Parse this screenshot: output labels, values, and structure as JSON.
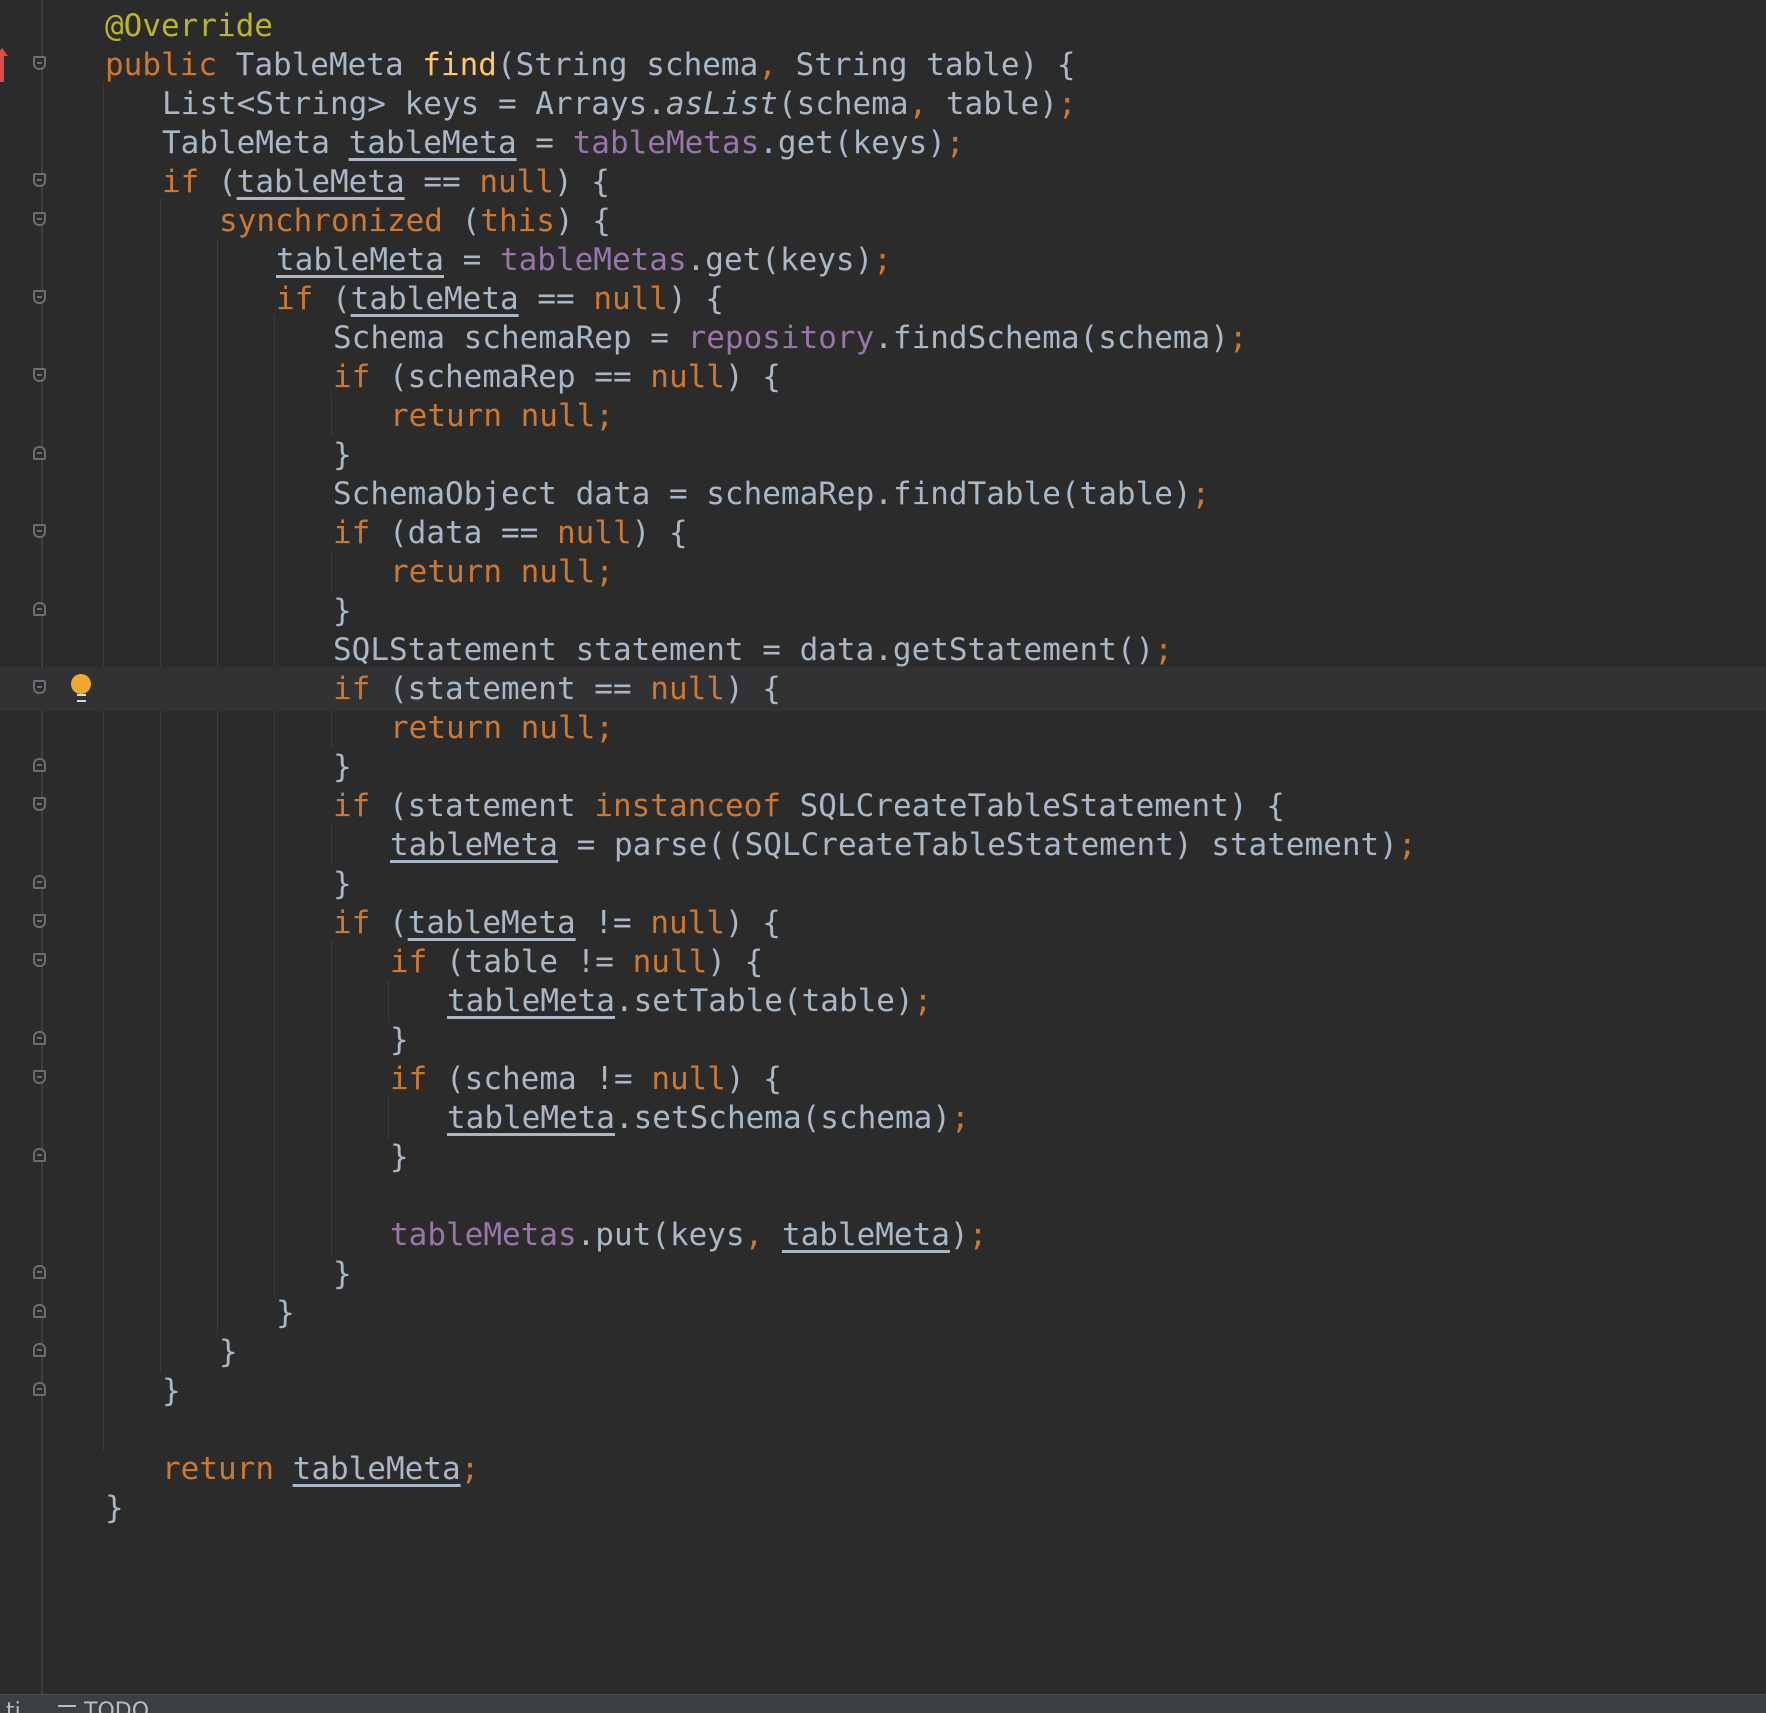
{
  "editor": {
    "language": "java",
    "colors": {
      "background": "#2b2b2c",
      "current_line": "#323234",
      "plain": "#a9b7c6",
      "keyword": "#cc7832",
      "annotation": "#bbb529",
      "method_declaration": "#ffc66d",
      "field": "#9876aa",
      "gutter_icon": "#6a6e72",
      "intention_bulb": "#f0a830",
      "change_marker": "#d94f47"
    },
    "lines": [
      [
        {
          "t": "@Override",
          "c": "annotation"
        }
      ],
      [
        {
          "t": "public ",
          "c": "keyword"
        },
        {
          "t": "TableMeta "
        },
        {
          "t": "find",
          "c": "method_declaration"
        },
        {
          "t": "(String schema"
        },
        {
          "t": ", ",
          "c": "keyword"
        },
        {
          "t": "String table) {"
        }
      ],
      [
        {
          "t": "List<String> keys = Arrays."
        },
        {
          "t": "asList",
          "c": "italic"
        },
        {
          "t": "(schema"
        },
        {
          "t": ", ",
          "c": "keyword"
        },
        {
          "t": "table)"
        },
        {
          "t": ";",
          "c": "keyword"
        }
      ],
      [
        {
          "t": "TableMeta "
        },
        {
          "t": "tableMeta",
          "c": "var"
        },
        {
          "t": " = "
        },
        {
          "t": "tableMetas",
          "c": "field"
        },
        {
          "t": ".get(keys)"
        },
        {
          "t": ";",
          "c": "keyword"
        }
      ],
      [
        {
          "t": "if ",
          "c": "keyword"
        },
        {
          "t": "("
        },
        {
          "t": "tableMeta",
          "c": "var"
        },
        {
          "t": " == "
        },
        {
          "t": "null",
          "c": "keyword"
        },
        {
          "t": ") {"
        }
      ],
      [
        {
          "t": "synchronized ",
          "c": "keyword"
        },
        {
          "t": "("
        },
        {
          "t": "this",
          "c": "keyword"
        },
        {
          "t": ") {"
        }
      ],
      [
        {
          "t": "tableMeta",
          "c": "var"
        },
        {
          "t": " = "
        },
        {
          "t": "tableMetas",
          "c": "field"
        },
        {
          "t": ".get(keys)"
        },
        {
          "t": ";",
          "c": "keyword"
        }
      ],
      [
        {
          "t": "if ",
          "c": "keyword"
        },
        {
          "t": "("
        },
        {
          "t": "tableMeta",
          "c": "var"
        },
        {
          "t": " == "
        },
        {
          "t": "null",
          "c": "keyword"
        },
        {
          "t": ") {"
        }
      ],
      [
        {
          "t": "Schema schemaRep = "
        },
        {
          "t": "repository",
          "c": "field"
        },
        {
          "t": ".findSchema(schema)"
        },
        {
          "t": ";",
          "c": "keyword"
        }
      ],
      [
        {
          "t": "if ",
          "c": "keyword"
        },
        {
          "t": "(schemaRep == "
        },
        {
          "t": "null",
          "c": "keyword"
        },
        {
          "t": ") {"
        }
      ],
      [
        {
          "t": "return null;",
          "c": "keyword"
        }
      ],
      [
        {
          "t": "}"
        }
      ],
      [
        {
          "t": "SchemaObject data = schemaRep.findTable(table)"
        },
        {
          "t": ";",
          "c": "keyword"
        }
      ],
      [
        {
          "t": "if ",
          "c": "keyword"
        },
        {
          "t": "(data == "
        },
        {
          "t": "null",
          "c": "keyword"
        },
        {
          "t": ") {"
        }
      ],
      [
        {
          "t": "return null;",
          "c": "keyword"
        }
      ],
      [
        {
          "t": "}"
        }
      ],
      [
        {
          "t": "SQLStatement statement = data.getStatement()"
        },
        {
          "t": ";",
          "c": "keyword"
        }
      ],
      [
        {
          "t": "if ",
          "c": "keyword"
        },
        {
          "t": "(statement == "
        },
        {
          "t": "null",
          "c": "keyword"
        },
        {
          "t": ") {"
        }
      ],
      [
        {
          "t": "return null;",
          "c": "keyword"
        }
      ],
      [
        {
          "t": "}"
        }
      ],
      [
        {
          "t": "if ",
          "c": "keyword"
        },
        {
          "t": "(statement "
        },
        {
          "t": "instanceof ",
          "c": "keyword"
        },
        {
          "t": "SQLCreateTableStatement) {"
        }
      ],
      [
        {
          "t": "tableMeta",
          "c": "var"
        },
        {
          "t": " = parse((SQLCreateTableStatement) statement)"
        },
        {
          "t": ";",
          "c": "keyword"
        }
      ],
      [
        {
          "t": "}"
        }
      ],
      [
        {
          "t": "if ",
          "c": "keyword"
        },
        {
          "t": "("
        },
        {
          "t": "tableMeta",
          "c": "var"
        },
        {
          "t": " != "
        },
        {
          "t": "null",
          "c": "keyword"
        },
        {
          "t": ") {"
        }
      ],
      [
        {
          "t": "if ",
          "c": "keyword"
        },
        {
          "t": "(table != "
        },
        {
          "t": "null",
          "c": "keyword"
        },
        {
          "t": ") {"
        }
      ],
      [
        {
          "t": "tableMeta",
          "c": "var"
        },
        {
          "t": ".setTable(table)"
        },
        {
          "t": ";",
          "c": "keyword"
        }
      ],
      [
        {
          "t": "}"
        }
      ],
      [
        {
          "t": "if ",
          "c": "keyword"
        },
        {
          "t": "(schema != "
        },
        {
          "t": "null",
          "c": "keyword"
        },
        {
          "t": ") {"
        }
      ],
      [
        {
          "t": "tableMeta",
          "c": "var"
        },
        {
          "t": ".setSchema(schema)"
        },
        {
          "t": ";",
          "c": "keyword"
        }
      ],
      [
        {
          "t": "}"
        }
      ],
      [],
      [
        {
          "t": "tableMetas",
          "c": "field"
        },
        {
          "t": ".put(keys"
        },
        {
          "t": ", ",
          "c": "keyword"
        },
        {
          "t": "tableMeta",
          "c": "var"
        },
        {
          "t": ")"
        },
        {
          "t": ";",
          "c": "keyword"
        }
      ],
      [
        {
          "t": "}"
        }
      ],
      [
        {
          "t": "}"
        }
      ],
      [
        {
          "t": "}"
        }
      ],
      [
        {
          "t": "}"
        }
      ],
      [],
      [
        {
          "t": "return ",
          "c": "keyword"
        },
        {
          "t": "tableMeta",
          "c": "var"
        },
        {
          "t": ";",
          "c": "keyword"
        }
      ],
      [
        {
          "t": "}"
        }
      ]
    ],
    "gutter": {
      "change_marker": "modified",
      "intention_icon": "lightbulb-icon"
    }
  },
  "status_bar": {
    "left_text": "ti",
    "todo_tab": "TODO",
    "todo_icon": "list-icon"
  }
}
